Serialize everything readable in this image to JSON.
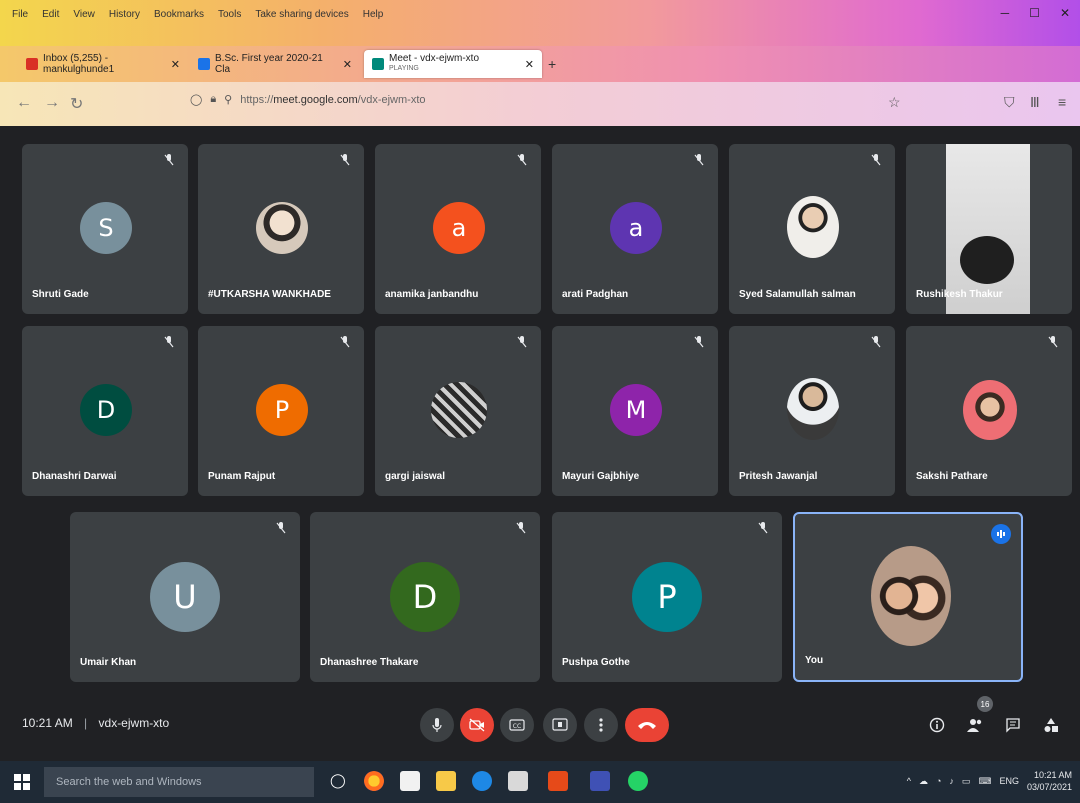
{
  "browser": {
    "menu": [
      "File",
      "Edit",
      "View",
      "History",
      "Bookmarks",
      "Tools",
      "Take sharing devices",
      "Help"
    ],
    "tabs": [
      {
        "title": "Inbox (5,255) - mankulghunde1",
        "color": "#d93025"
      },
      {
        "title": "B.Sc. First year 2020-21 Cla",
        "color": "#1a73e8"
      },
      {
        "title": "Meet - vdx-ejwm-xto",
        "subtitle": "PLAYING",
        "color": "#00897b"
      }
    ],
    "url_prefix": "https://",
    "url_domain": "meet.google.com",
    "url_path": "/vdx-ejwm-xto"
  },
  "meeting": {
    "time": "10:21 AM",
    "separator": "|",
    "code": "vdx-ejwm-xto",
    "participant_count": "16",
    "participants": [
      {
        "name": "Shruti Gade",
        "initial": "S",
        "color": "#78909c",
        "type": "initial"
      },
      {
        "name": "#UTKARSHA WANKHADE",
        "type": "photo",
        "color": "#c9b9a8"
      },
      {
        "name": "anamika janbandhu",
        "initial": "a",
        "color": "#f4511e",
        "type": "initial"
      },
      {
        "name": "arati Padghan",
        "initial": "a",
        "color": "#5e35b1",
        "type": "initial"
      },
      {
        "name": "Syed Salamullah salman",
        "type": "photo",
        "color": "#d7ccc8"
      },
      {
        "name": "Rushikesh Thakur",
        "type": "video",
        "color": "#e6e6e6"
      },
      {
        "name": "Dhanashri Darwai",
        "initial": "D",
        "color": "#004d40",
        "type": "initial"
      },
      {
        "name": "Punam Rajput",
        "initial": "P",
        "color": "#ef6c00",
        "type": "initial"
      },
      {
        "name": "gargi jaiswal",
        "type": "photo",
        "color": "#9e9e9e"
      },
      {
        "name": "Mayuri Gajbhiye",
        "initial": "M",
        "color": "#8e24aa",
        "type": "initial"
      },
      {
        "name": "Pritesh Jawanjal",
        "type": "photo",
        "color": "#cfd8dc"
      },
      {
        "name": "Sakshi Pathare",
        "type": "photo",
        "color": "#f8bbd0"
      },
      {
        "name": "Umair Khan",
        "initial": "U",
        "color": "#78909c",
        "type": "initial"
      },
      {
        "name": "Dhanashree Thakare",
        "initial": "D",
        "color": "#33691e",
        "type": "initial"
      },
      {
        "name": "Pushpa Gothe",
        "initial": "P",
        "color": "#00838f",
        "type": "initial"
      },
      {
        "name": "You",
        "type": "photo",
        "color": "#a1887f"
      }
    ]
  },
  "taskbar": {
    "search_placeholder": "Search the web and Windows",
    "lang": "ENG",
    "time": "10:21 AM",
    "date": "03/07/2021"
  }
}
